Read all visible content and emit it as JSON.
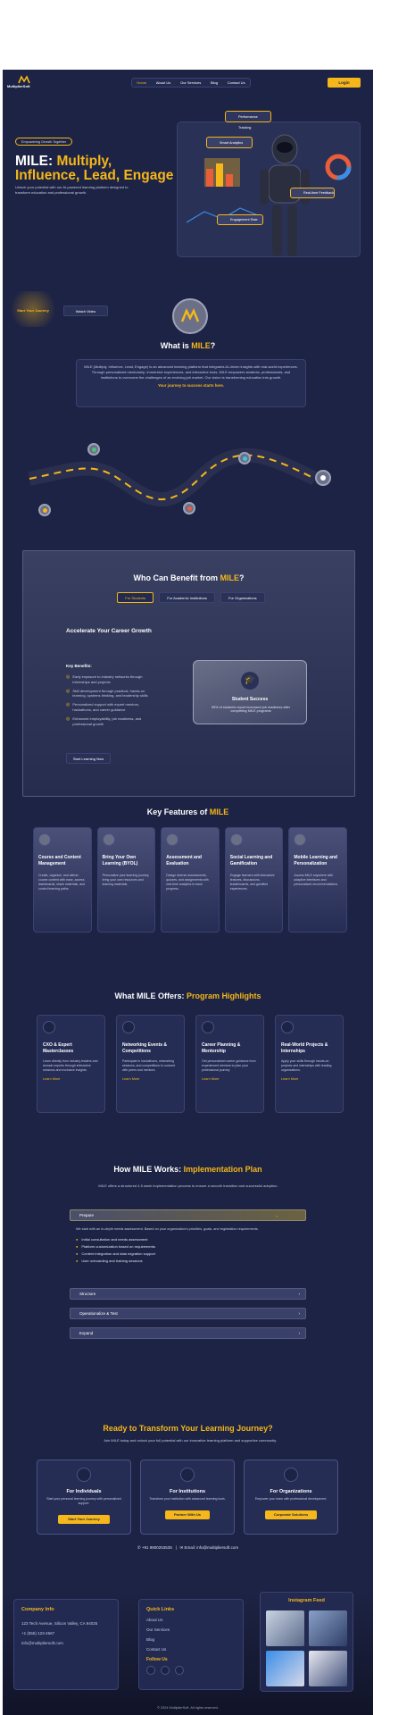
{
  "nav": {
    "brand": "MultiplierSoft",
    "links": [
      "Home",
      "About Us",
      "Our Services",
      "Blog",
      "Contact Us"
    ],
    "cta": "Login"
  },
  "hero": {
    "badge": "Empowering Growth Together",
    "title_white": "MILE: ",
    "title_yellow": "Multiply, Influence, Lead, Engage",
    "subtitle": "Unlock your potential with our AI-powered learning platform designed to transform education and professional growth.",
    "btn_primary": "Start Your Journey",
    "btn_secondary": "Watch Video",
    "card_top": "Performance Tracking",
    "card_mid": "Smart Analytics",
    "card_right": "Real-time Feedback",
    "card_bottom": "Engagement Rate"
  },
  "what": {
    "title_white": "What is ",
    "title_yellow": "MILE",
    "title_q": "?",
    "body": "MILE (Multiply, Influence, Lead, Engage) is an advanced learning platform that integrates AI-driven insights with real-world experiences. Through personalized mentorship, immersive experiences, and interactive tools, MILE empowers students, professionals, and institutions to overcome the challenges of an evolving job market. Our vision is transforming education into growth.",
    "link": "Your journey to success starts here."
  },
  "benefit": {
    "title_white": "Who Can Benefit from ",
    "title_yellow": "MILE",
    "title_q": "?",
    "tabs": [
      "For Students",
      "For Academic Institutions",
      "For Organizations"
    ],
    "heading": "Accelerate Your Career Growth",
    "key_title": "Key Benefits:",
    "benefits": [
      "Early exposure to industry networks through internships and projects",
      "Skill development through practical, hands-on learning, systems thinking, and leadership skills",
      "Personalized support with expert mentors, hackathons, and career guidance",
      "Enhanced employability, job readiness, and professional growth"
    ],
    "cta": "Start Learning Now",
    "stat_title": "Student Success",
    "stat_body": "95% of students report increased job readiness after completing MILE programs"
  },
  "features": {
    "title_white": "Key Features of ",
    "title_yellow": "MILE",
    "items": [
      {
        "title": "Course and Content Management",
        "desc": "Create, organize, and deliver course content with ease, access dashboards, share materials, and control learning paths."
      },
      {
        "title": "Bring Your Own Learning (BYOL)",
        "desc": "Personalize your learning journey, bring your own resources and learning materials."
      },
      {
        "title": "Assessment and Evaluation",
        "desc": "Design diverse assessments, quizzes, and assignments with real-time analytics to track progress."
      },
      {
        "title": "Social Learning and Gamification",
        "desc": "Engage learners with interactive features, discussions, leaderboards, and gamified experiences."
      },
      {
        "title": "Mobile Learning and Personalization",
        "desc": "Access MILE anywhere with adaptive interfaces and personalized recommendations."
      }
    ]
  },
  "offers": {
    "title_white": "What MILE Offers: ",
    "title_yellow": "Program Highlights",
    "items": [
      {
        "title": "CXO & Expert Masterclasses",
        "desc": "Learn directly from industry leaders and domain experts through interactive sessions and exclusive insights.",
        "link": "Learn More"
      },
      {
        "title": "Networking Events & Competitions",
        "desc": "Participate in hackathons, networking sessions, and competitions to connect with peers and mentors.",
        "link": "Learn More"
      },
      {
        "title": "Career Planning & Mentorship",
        "desc": "Get personalized career guidance from experienced mentors to plan your professional journey.",
        "link": "Learn More"
      },
      {
        "title": "Real-World Projects & Internships",
        "desc": "Apply your skills through hands-on projects and internships with leading organizations.",
        "link": "Learn More"
      }
    ]
  },
  "how": {
    "title_white": "How MILE Works: ",
    "title_yellow": "Implementation Plan",
    "subtitle": "MILE offers a structured 4-5 week implementation process to ensure a smooth transition and successful adoption.",
    "steps": [
      "Prepare",
      "Structure",
      "Operationalize & Test",
      "Expand"
    ],
    "prepare_desc": "We start with an in-depth needs assessment. Based on your organization's priorities, goals, and registration requirements.",
    "prepare_items": [
      "Initial consultation and needs assessment",
      "Platform customization based on requirements",
      "Content integration and data migration support",
      "User onboarding and training sessions"
    ]
  },
  "ready": {
    "title": "Ready to Transform Your Learning Journey?",
    "subtitle": "Join MILE today and unlock your full potential with our innovative learning platform and supportive community.",
    "cards": [
      {
        "title": "For Individuals",
        "desc": "Start your personal learning journey with personalized support.",
        "btn": "Start Your Journey"
      },
      {
        "title": "For Institutions",
        "desc": "Transform your institution with advanced learning tools.",
        "btn": "Partner With Us"
      },
      {
        "title": "For Organizations",
        "desc": "Empower your team with professional development.",
        "btn": "Corporate Solutions"
      }
    ],
    "phone": "+91 9800253535",
    "email": "Email: info@multipliersoft.com"
  },
  "footer": {
    "company_title": "Company Info",
    "company_lines": [
      "123 Tech Avenue, Silicon Valley, CA 94025",
      "+1 (555) 123-4567",
      "info@multipliersoft.com"
    ],
    "links_title": "Quick Links",
    "links": [
      "About Us",
      "Our Services",
      "Blog",
      "Contact Us"
    ],
    "follow_title": "Follow Us",
    "insta_title": "Instagram Feed",
    "copyright": "© 2024 MultiplierSoft. All rights reserved."
  },
  "colors": {
    "bg": "#1d2344",
    "accent": "#f5b719",
    "card": "#262d55"
  }
}
